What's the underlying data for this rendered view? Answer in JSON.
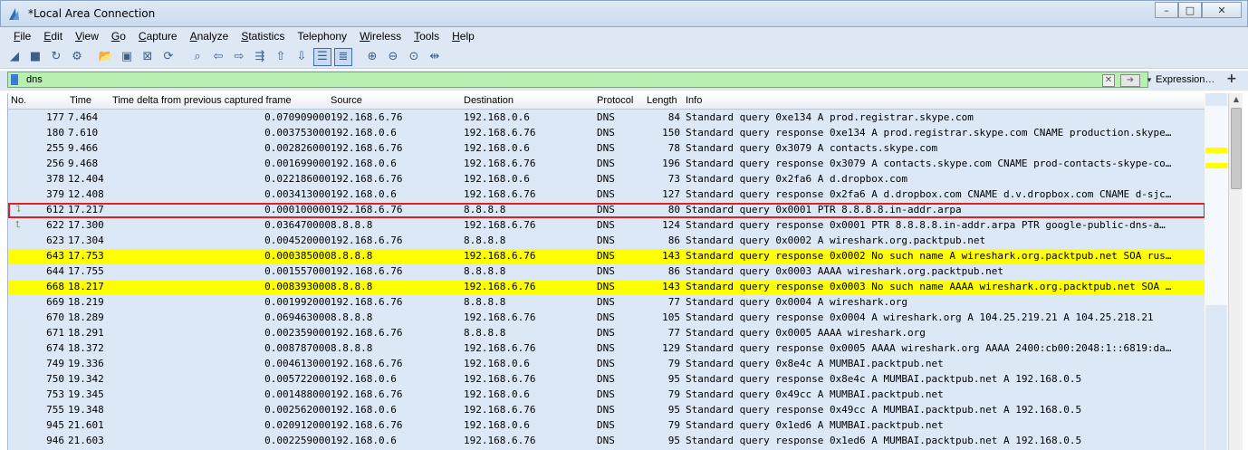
{
  "window": {
    "title": "*Local Area Connection",
    "minimize": "–",
    "maximize": "□",
    "close": "✕"
  },
  "menu": [
    {
      "label": "File",
      "acc": "F",
      "rest": "ile"
    },
    {
      "label": "Edit",
      "acc": "E",
      "rest": "dit"
    },
    {
      "label": "View",
      "acc": "V",
      "rest": "iew"
    },
    {
      "label": "Go",
      "acc": "G",
      "rest": "o"
    },
    {
      "label": "Capture",
      "acc": "C",
      "rest": "apture"
    },
    {
      "label": "Analyze",
      "acc": "A",
      "rest": "nalyze"
    },
    {
      "label": "Statistics",
      "acc": "S",
      "rest": "tatistics"
    },
    {
      "label": "Telephony",
      "acc": "",
      "rest": "Telephony"
    },
    {
      "label": "Wireless",
      "acc": "W",
      "rest": "ireless"
    },
    {
      "label": "Tools",
      "acc": "T",
      "rest": "ools"
    },
    {
      "label": "Help",
      "acc": "H",
      "rest": "elp"
    }
  ],
  "toolbar": {
    "icons": [
      "shark-fin-icon",
      "stop-icon",
      "restart-icon",
      "options-gear-icon",
      "open-file-icon",
      "save-file-icon",
      "close-file-icon",
      "reload-icon",
      "find-icon",
      "go-back-icon",
      "go-forward-icon",
      "go-to-packet-icon",
      "go-first-icon",
      "go-last-icon",
      "autoscroll-icon",
      "colorize-icon",
      "zoom-in-icon",
      "zoom-out-icon",
      "zoom-normal-icon",
      "resize-columns-icon"
    ]
  },
  "filter": {
    "value": "dns",
    "expression_label": "Expression…",
    "add_label": "+"
  },
  "columns": {
    "no": "No.",
    "time": "Time",
    "delta": "Time delta from previous captured frame",
    "source": "Source",
    "destination": "Destination",
    "protocol": "Protocol",
    "length": "Length",
    "info": "Info"
  },
  "packets": [
    {
      "no": "177",
      "time": "7.464",
      "delta": "0.070909000",
      "src": "192.168.6.76",
      "dst": "192.168.0.6",
      "proto": "DNS",
      "len": "84",
      "info": "Standard query 0xe134 A prod.registrar.skype.com",
      "highlight": ""
    },
    {
      "no": "180",
      "time": "7.610",
      "delta": "0.003753000",
      "src": "192.168.0.6",
      "dst": "192.168.6.76",
      "proto": "DNS",
      "len": "150",
      "info": "Standard query response 0xe134 A prod.registrar.skype.com CNAME production.skype…",
      "highlight": ""
    },
    {
      "no": "255",
      "time": "9.466",
      "delta": "0.002826000",
      "src": "192.168.6.76",
      "dst": "192.168.0.6",
      "proto": "DNS",
      "len": "78",
      "info": "Standard query 0x3079 A contacts.skype.com",
      "highlight": ""
    },
    {
      "no": "256",
      "time": "9.468",
      "delta": "0.001699000",
      "src": "192.168.0.6",
      "dst": "192.168.6.76",
      "proto": "DNS",
      "len": "196",
      "info": "Standard query response 0x3079 A contacts.skype.com CNAME prod-contacts-skype-co…",
      "highlight": ""
    },
    {
      "no": "378",
      "time": "12.404",
      "delta": "0.022186000",
      "src": "192.168.6.76",
      "dst": "192.168.0.6",
      "proto": "DNS",
      "len": "73",
      "info": "Standard query 0x2fa6 A d.dropbox.com",
      "highlight": ""
    },
    {
      "no": "379",
      "time": "12.408",
      "delta": "0.003413000",
      "src": "192.168.0.6",
      "dst": "192.168.6.76",
      "proto": "DNS",
      "len": "127",
      "info": "Standard query response 0x2fa6 A d.dropbox.com CNAME d.v.dropbox.com CNAME d-sjc…",
      "highlight": ""
    },
    {
      "no": "612",
      "time": "17.217",
      "delta": "0.000100000",
      "src": "192.168.6.76",
      "dst": "8.8.8.8",
      "proto": "DNS",
      "len": "80",
      "info": "Standard query 0x0001 PTR 8.8.8.8.in-addr.arpa",
      "highlight": "selected"
    },
    {
      "no": "622",
      "time": "17.300",
      "delta": "0.036470000",
      "src": "8.8.8.8",
      "dst": "192.168.6.76",
      "proto": "DNS",
      "len": "124",
      "info": "Standard query response 0x0001 PTR 8.8.8.8.in-addr.arpa PTR google-public-dns-a…",
      "highlight": ""
    },
    {
      "no": "623",
      "time": "17.304",
      "delta": "0.004520000",
      "src": "192.168.6.76",
      "dst": "8.8.8.8",
      "proto": "DNS",
      "len": "86",
      "info": "Standard query 0x0002 A wireshark.org.packtpub.net",
      "highlight": ""
    },
    {
      "no": "643",
      "time": "17.753",
      "delta": "0.000385000",
      "src": "8.8.8.8",
      "dst": "192.168.6.76",
      "proto": "DNS",
      "len": "143",
      "info": "Standard query response 0x0002 No such name A wireshark.org.packtpub.net SOA rus…",
      "highlight": "yellow"
    },
    {
      "no": "644",
      "time": "17.755",
      "delta": "0.001557000",
      "src": "192.168.6.76",
      "dst": "8.8.8.8",
      "proto": "DNS",
      "len": "86",
      "info": "Standard query 0x0003 AAAA wireshark.org.packtpub.net",
      "highlight": ""
    },
    {
      "no": "668",
      "time": "18.217",
      "delta": "0.008393000",
      "src": "8.8.8.8",
      "dst": "192.168.6.76",
      "proto": "DNS",
      "len": "143",
      "info": "Standard query response 0x0003 No such name AAAA wireshark.org.packtpub.net SOA …",
      "highlight": "yellow"
    },
    {
      "no": "669",
      "time": "18.219",
      "delta": "0.001992000",
      "src": "192.168.6.76",
      "dst": "8.8.8.8",
      "proto": "DNS",
      "len": "77",
      "info": "Standard query 0x0004 A wireshark.org",
      "highlight": ""
    },
    {
      "no": "670",
      "time": "18.289",
      "delta": "0.069463000",
      "src": "8.8.8.8",
      "dst": "192.168.6.76",
      "proto": "DNS",
      "len": "105",
      "info": "Standard query response 0x0004 A wireshark.org A 104.25.219.21 A 104.25.218.21",
      "highlight": ""
    },
    {
      "no": "671",
      "time": "18.291",
      "delta": "0.002359000",
      "src": "192.168.6.76",
      "dst": "8.8.8.8",
      "proto": "DNS",
      "len": "77",
      "info": "Standard query 0x0005 AAAA wireshark.org",
      "highlight": ""
    },
    {
      "no": "674",
      "time": "18.372",
      "delta": "0.008787000",
      "src": "8.8.8.8",
      "dst": "192.168.6.76",
      "proto": "DNS",
      "len": "129",
      "info": "Standard query response 0x0005 AAAA wireshark.org AAAA 2400:cb00:2048:1::6819:da…",
      "highlight": ""
    },
    {
      "no": "749",
      "time": "19.336",
      "delta": "0.004613000",
      "src": "192.168.6.76",
      "dst": "192.168.0.6",
      "proto": "DNS",
      "len": "79",
      "info": "Standard query 0x8e4c A MUMBAI.packtpub.net",
      "highlight": ""
    },
    {
      "no": "750",
      "time": "19.342",
      "delta": "0.005722000",
      "src": "192.168.0.6",
      "dst": "192.168.6.76",
      "proto": "DNS",
      "len": "95",
      "info": "Standard query response 0x8e4c A MUMBAI.packtpub.net A 192.168.0.5",
      "highlight": ""
    },
    {
      "no": "753",
      "time": "19.345",
      "delta": "0.001488000",
      "src": "192.168.6.76",
      "dst": "192.168.0.6",
      "proto": "DNS",
      "len": "79",
      "info": "Standard query 0x49cc A MUMBAI.packtpub.net",
      "highlight": ""
    },
    {
      "no": "755",
      "time": "19.348",
      "delta": "0.002562000",
      "src": "192.168.0.6",
      "dst": "192.168.6.76",
      "proto": "DNS",
      "len": "95",
      "info": "Standard query response 0x49cc A MUMBAI.packtpub.net A 192.168.0.5",
      "highlight": ""
    },
    {
      "no": "945",
      "time": "21.601",
      "delta": "0.020912000",
      "src": "192.168.6.76",
      "dst": "192.168.0.6",
      "proto": "DNS",
      "len": "79",
      "info": "Standard query 0x1ed6 A MUMBAI.packtpub.net",
      "highlight": ""
    },
    {
      "no": "946",
      "time": "21.603",
      "delta": "0.002259000",
      "src": "192.168.0.6",
      "dst": "192.168.6.76",
      "proto": "DNS",
      "len": "95",
      "info": "Standard query response 0x1ed6 A MUMBAI.packtpub.net A 192.168.0.5",
      "highlight": ""
    }
  ],
  "colors": {
    "row_bg": "#dce8f6",
    "highlight_yellow": "#ffff00",
    "selection_outline": "#e02020",
    "filter_ok_bg": "#b7f0b0"
  }
}
